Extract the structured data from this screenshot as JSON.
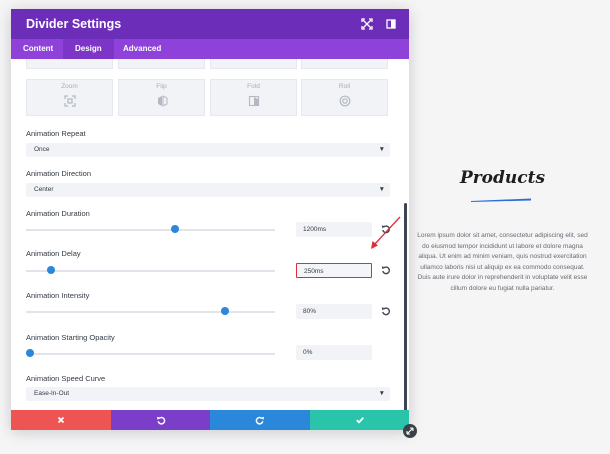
{
  "modal": {
    "title": "Divider Settings",
    "icons": {
      "expand": "expand-icon",
      "dock": "sidebar-dock-icon"
    },
    "tabs": [
      {
        "label": "Content",
        "active": false
      },
      {
        "label": "Design",
        "active": true
      },
      {
        "label": "Advanced",
        "active": false
      }
    ]
  },
  "animation_styles": [
    {
      "label": "Zoom",
      "icon": "zoom-icon"
    },
    {
      "label": "Flip",
      "icon": "flip-icon"
    },
    {
      "label": "Fold",
      "icon": "fold-icon"
    },
    {
      "label": "Roll",
      "icon": "roll-icon"
    }
  ],
  "fields": {
    "repeat": {
      "label": "Animation Repeat",
      "value": "Once"
    },
    "direction": {
      "label": "Animation Direction",
      "value": "Center"
    },
    "duration": {
      "label": "Animation Duration",
      "value": "1200ms",
      "level_percent": 60
    },
    "delay": {
      "label": "Animation Delay",
      "value": "250ms",
      "level_percent": 10
    },
    "intensity": {
      "label": "Animation Intensity",
      "value": "80%",
      "level_percent": 80
    },
    "opacity": {
      "label": "Animation Starting Opacity",
      "value": "0%",
      "level_percent": 0
    },
    "speed_curve": {
      "label": "Animation Speed Curve",
      "value": "Ease-In-Out"
    }
  },
  "footer": {
    "cancel_icon": "close-icon",
    "undo_icon": "undo-icon",
    "redo_icon": "redo-icon",
    "save_icon": "check-icon"
  },
  "colors": {
    "header": "#6c2eb9",
    "tabbar": "#8e42d9",
    "accent_blue": "#2b87da",
    "cancel": "#ef5455",
    "undo": "#7b3ec8",
    "redo": "#2b87da",
    "save": "#29c4a9",
    "highlight": "#e02b3a"
  },
  "products": {
    "title": "Products",
    "body": "Lorem ipsum dolor sit amet, consectetur adipiscing elit, sed do eiusmod tempor incididunt ut labore et dolore magna aliqua. Ut enim ad minim veniam, quis nostrud exercitation ullamco laboris nisi ut aliquip ex ea commodo consequat. Duis aute irure dolor in reprehenderit in voluptate velit esse cillum dolore eu fugiat nulla pariatur."
  }
}
